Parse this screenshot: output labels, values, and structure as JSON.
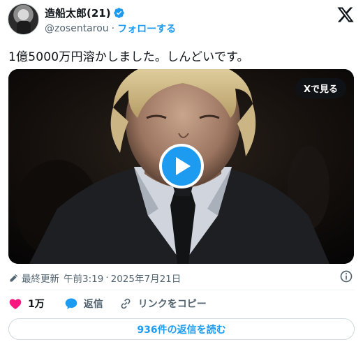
{
  "author": {
    "display_name": "造船太郎(21)",
    "handle": "@zosentarou",
    "follow_label": "フォローする"
  },
  "tweet": {
    "text": "1億5000万円溶かしました。しんどいです。"
  },
  "media": {
    "watch_on_x_label": "Xで見る"
  },
  "meta": {
    "edited_label": "最終更新",
    "time": "午前3:19",
    "separator": "·",
    "date": "2025年7月21日"
  },
  "actions": {
    "like_count": "1万",
    "reply_label": "返信",
    "copy_link_label": "リンクをコピー"
  },
  "read_replies_label": "936件の返信を読む",
  "colors": {
    "accent": "#1d9bf0",
    "like": "#f91880",
    "text_primary": "#0f1419",
    "text_secondary": "#536471",
    "border": "#cfd9de"
  }
}
